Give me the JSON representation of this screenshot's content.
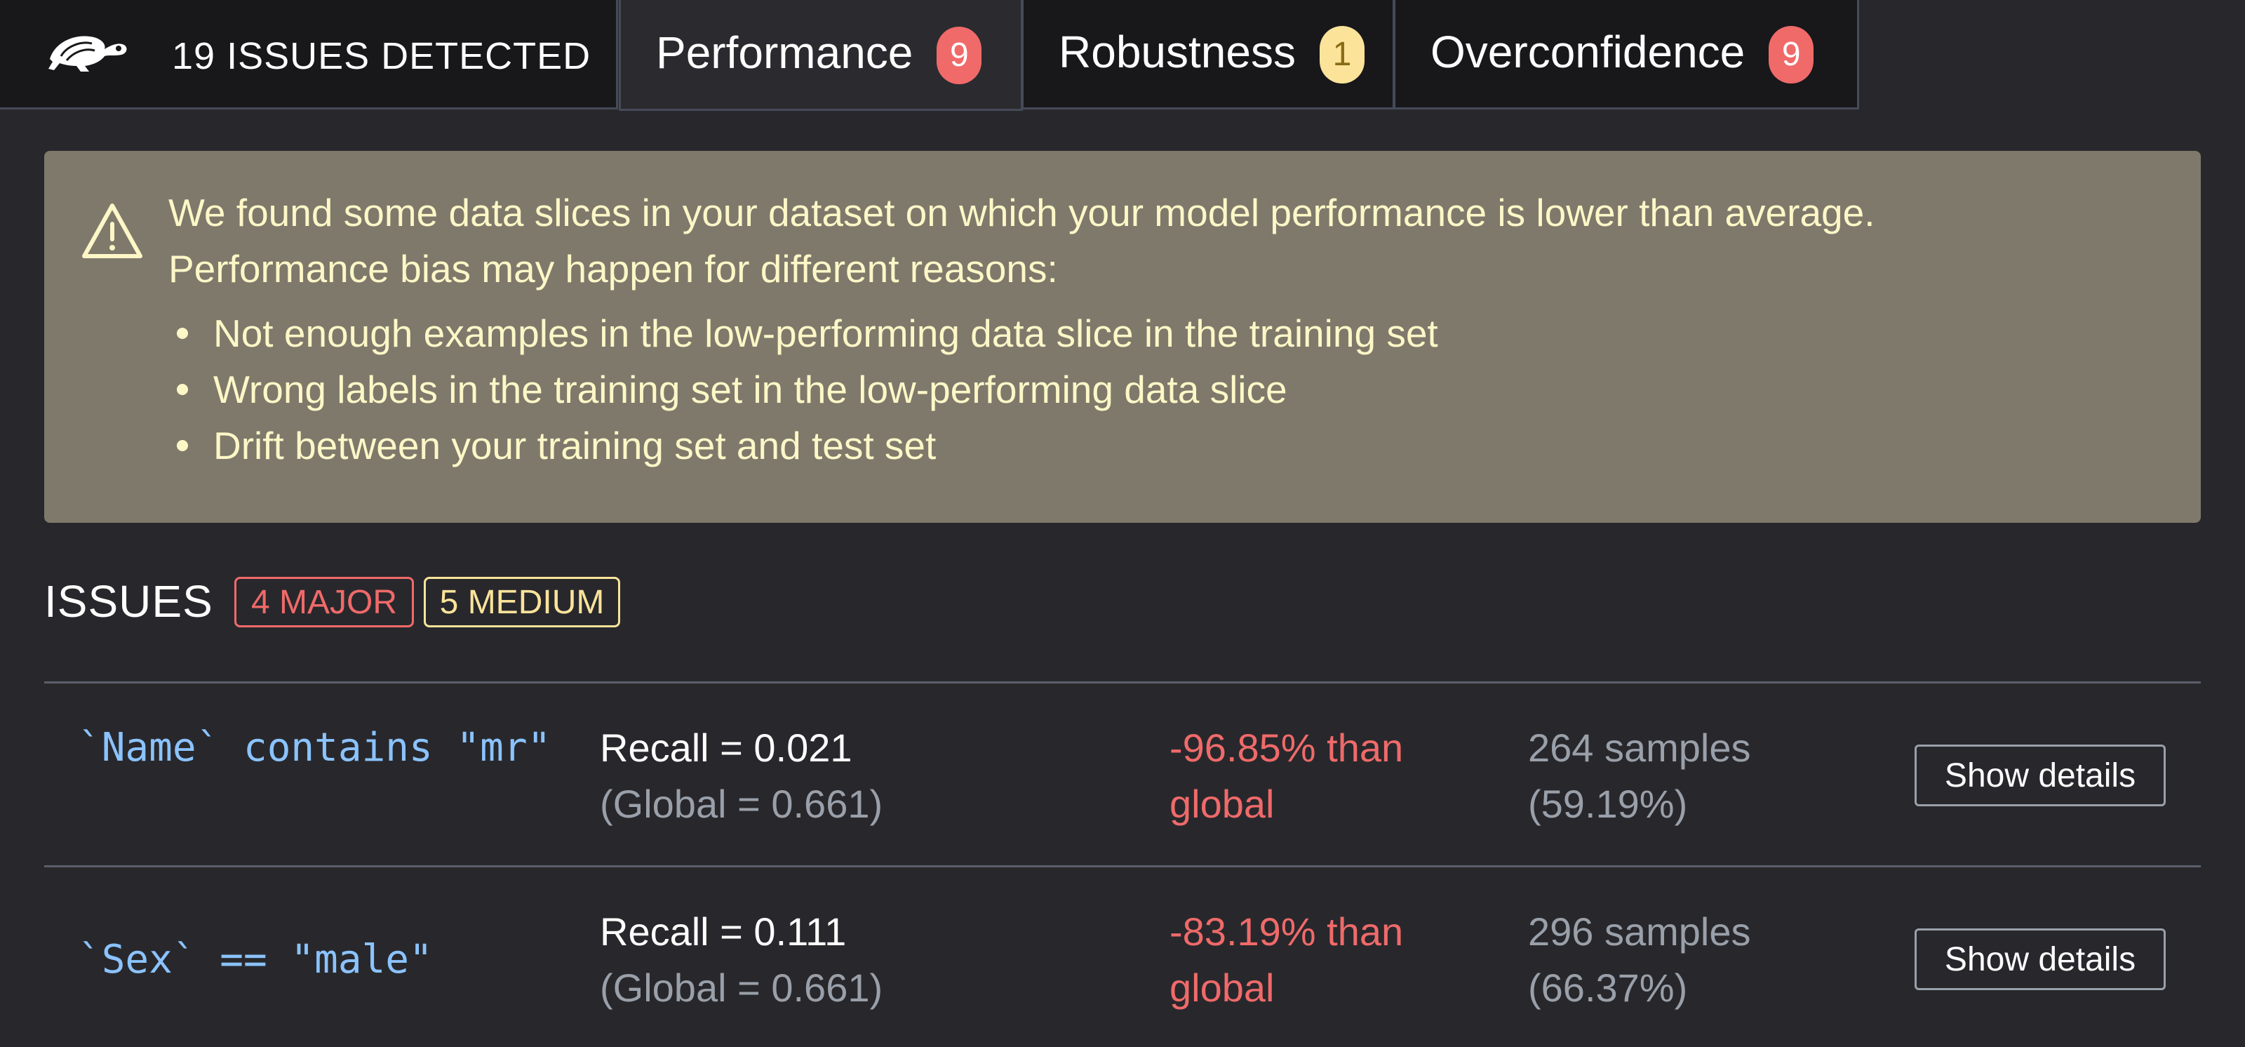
{
  "header": {
    "title": "19 ISSUES DETECTED"
  },
  "tabs": [
    {
      "label": "Performance",
      "count": "9",
      "badge_color": "#f06a6a",
      "active": true
    },
    {
      "label": "Robustness",
      "count": "1",
      "badge_color": "#fbe39a",
      "active": false
    },
    {
      "label": "Overconfidence",
      "count": "9",
      "badge_color": "#f06a6a",
      "active": false
    }
  ],
  "alert": {
    "line1": "We found some data slices in your dataset on which your model performance is lower than average.",
    "line2": "Performance bias may happen for different reasons:",
    "reasons": [
      "Not enough examples in the low-performing data slice in the training set",
      "Wrong labels in the training set in the low-performing data slice",
      "Drift between your training set and test set"
    ]
  },
  "issues": {
    "title": "ISSUES",
    "major_label": "4 MAJOR",
    "medium_label": "5 MEDIUM",
    "rows": [
      {
        "slice": "`Name` contains \"mr\"",
        "metric": "Recall = 0.021",
        "global": "(Global = 0.661)",
        "delta_line1": "-96.85% than",
        "delta_line2": "global",
        "samples": "264 samples",
        "samples_pct": "(59.19%)",
        "button": "Show details"
      },
      {
        "slice": "`Sex` == \"male\"",
        "metric": "Recall = 0.111",
        "global": "(Global = 0.661)",
        "delta_line1": "-83.19% than",
        "delta_line2": "global",
        "samples": "296 samples",
        "samples_pct": "(66.37%)",
        "button": "Show details"
      }
    ]
  },
  "colors": {
    "background": "#28282c",
    "alert_bg": "#7e796b",
    "alert_text": "#fdf7c7",
    "slice_text": "#8bc3ff",
    "major": "#f06a6a",
    "medium": "#fbe39a"
  }
}
